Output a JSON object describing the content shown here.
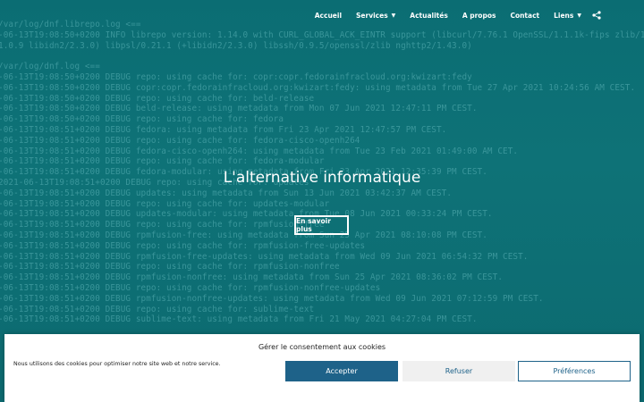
{
  "nav": {
    "items": [
      {
        "label": "Accueil",
        "dropdown": false
      },
      {
        "label": "Services",
        "dropdown": true
      },
      {
        "label": "Actualités",
        "dropdown": false
      },
      {
        "label": "A propos",
        "dropdown": false
      },
      {
        "label": "Contact",
        "dropdown": false
      },
      {
        "label": "Liens",
        "dropdown": true
      }
    ],
    "share_icon": "share-icon",
    "caret_glyph": "▼"
  },
  "hero": {
    "terminal_lines": [
      "/var/log/dnf.librepo.log <==",
      "-06-13T19:08:50+0200 INFO librepo version: 1.14.0 with CURL_GLOBAL_ACK_EINTR support (libcurl/7.76.1 OpenSSL/1.1.1k-fips zlib/1.2.11",
      "1.0.9 libidn2/2.3.0) libpsl/0.21.1 (+libidn2/2.3.0) libssh/0.9.5/openssl/zlib nghttp2/1.43.0)",
      "",
      "/var/log/dnf.log <==",
      "-06-13T19:08:50+0200 DEBUG repo: using cache for: copr:copr.fedorainfracloud.org:kwizart:fedy",
      "-06-13T19:08:50+0200 DEBUG copr:copr.fedorainfracloud.org:kwizart:fedy: using metadata from Tue 27 Apr 2021 10:24:56 AM CEST.",
      "-06-13T19:08:50+0200 DEBUG repo: using cache for: beld-release",
      "-06-13T19:08:50+0200 DEBUG beld-release: using metadata from Mon 07 Jun 2021 12:47:11 PM CEST.",
      "-06-13T19:08:50+0200 DEBUG repo: using cache for: fedora",
      "-06-13T19:08:51+0200 DEBUG fedora: using metadata from Fri 23 Apr 2021 12:47:57 PM CEST.",
      "-06-13T19:08:51+0200 DEBUG repo: using cache for: fedora-cisco-openh264",
      "-06-13T19:08:51+0200 DEBUG fedora-cisco-openh264: using metadata from Tue 23 Feb 2021 01:49:00 AM CET.",
      "-06-13T19:08:51+0200 DEBUG repo: using cache for: fedora-modular",
      "-06-13T19:08:51+0200 DEBUG fedora-modular: using metadata from Fri 23 Apr 2021 12:35:39 PM CEST.",
      "2021-06-13T19:08:51+0200 DEBUG repo: using cache for: updates",
      "-06-13T19:08:51+0200 DEBUG updates: using metadata from Sun 13 Jun 2021 03:42:37 AM CEST.",
      "-06-13T19:08:51+0200 DEBUG repo: using cache for: updates-modular",
      "-06-13T19:08:51+0200 DEBUG updates-modular: using metadata from Tue 08 Jun 2021 00:33:24 PM CEST.",
      "-06-13T19:08:51+0200 DEBUG repo: using cache for: rpmfusion-free",
      "-06-13T19:08:51+0200 DEBUG rpmfusion-free: using metadata from Sun 25 Apr 2021 08:10:08 PM CEST.",
      "-06-13T19:08:51+0200 DEBUG repo: using cache for: rpmfusion-free-updates",
      "-06-13T19:08:51+0200 DEBUG rpmfusion-free-updates: using metadata from Wed 09 Jun 2021 06:54:32 PM CEST.",
      "-06-13T19:08:51+0200 DEBUG repo: using cache for: rpmfusion-nonfree",
      "-06-13T19:08:51+0200 DEBUG rpmfusion-nonfree: using metadata from Sun 25 Apr 2021 08:36:02 PM CEST.",
      "-06-13T19:08:51+0200 DEBUG repo: using cache for: rpmfusion-nonfree-updates",
      "-06-13T19:08:51+0200 DEBUG rpmfusion-nonfree-updates: using metadata from Wed 09 Jun 2021 07:12:59 PM CEST.",
      "-06-13T19:08:51+0200 DEBUG repo: using cache for: sublime-text",
      "-06-13T19:08:51+0200 DEBUG sublime-text: using metadata from Fri 21 May 2021 04:27:04 PM CEST."
    ],
    "title": "L'alternative informatique",
    "button_label": "En savoir plus"
  },
  "cookie": {
    "title": "Gérer le consentement aux cookies",
    "text": "Nous utilisons des cookies pour optimiser notre site web et notre service.",
    "accept_label": "Accepter",
    "refuse_label": "Refuser",
    "prefs_label": "Préférences"
  },
  "colors": {
    "hero_bg": "#0f6f73",
    "accent_blue": "#1e6289",
    "terminal_text": "#5fb5b9"
  }
}
